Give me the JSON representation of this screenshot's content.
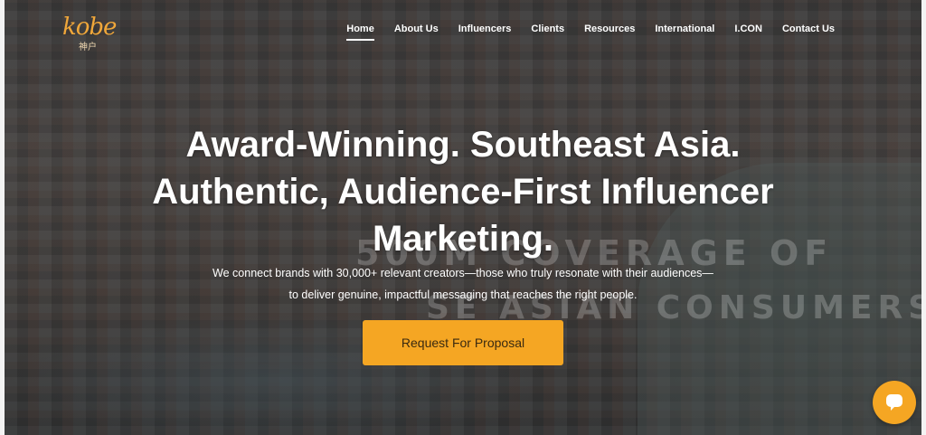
{
  "brand": {
    "logo_text": "kobe",
    "logo_sub": "神户",
    "accent_color": "#f5a623"
  },
  "nav": {
    "items": [
      {
        "label": "Home",
        "active": true
      },
      {
        "label": "About Us"
      },
      {
        "label": "Influencers"
      },
      {
        "label": "Clients"
      },
      {
        "label": "Resources"
      },
      {
        "label": "International"
      },
      {
        "label": "I.CON"
      },
      {
        "label": "Contact Us"
      }
    ]
  },
  "hero": {
    "background_text_line1": "500M COVERAGE OF",
    "background_text_line2": "SE ASIAN CONSUMERS",
    "headline_lines": [
      "Award-Winning. Southeast Asia.",
      "Authentic, Audience-First Influencer",
      "Marketing."
    ],
    "subtext_lines": [
      "We connect brands with 30,000+ relevant creators—those who truly resonate with their audiences—",
      "to deliver genuine, impactful messaging that reaches the right people."
    ],
    "cta_label": "Request For Proposal"
  },
  "chat_widget": {
    "icon": "chat-bubble-icon"
  }
}
